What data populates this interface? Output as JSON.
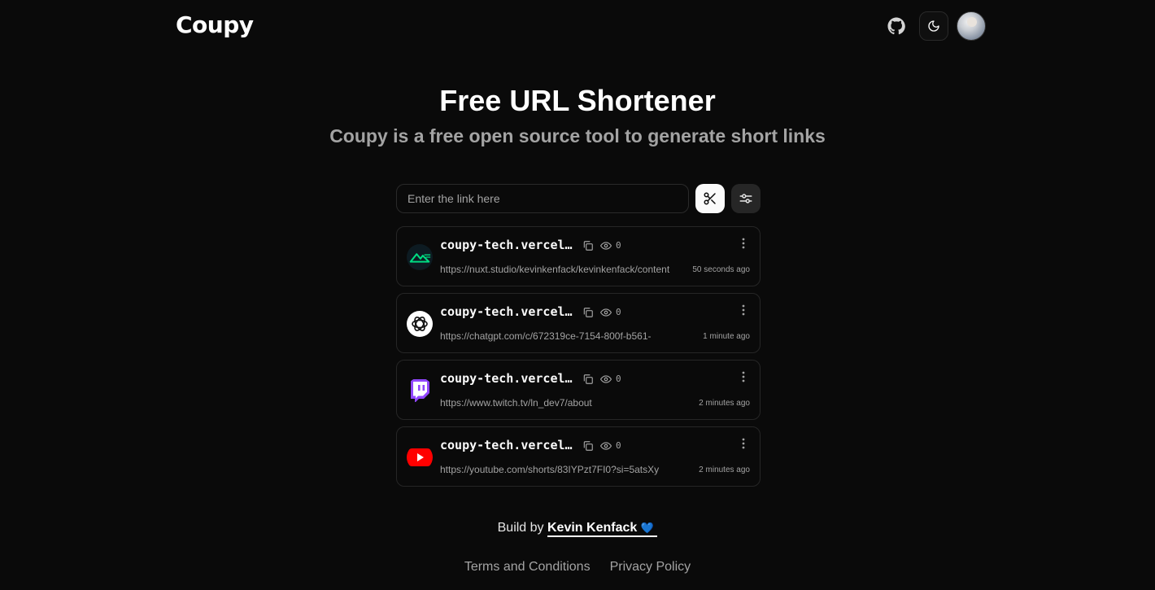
{
  "header": {
    "logo": "Coupy",
    "icons": [
      "github-icon",
      "moon-icon",
      "avatar"
    ]
  },
  "hero": {
    "title": "Free URL Shortener",
    "subtitle": "Coupy is a free open source tool to generate short links"
  },
  "shortener": {
    "input_placeholder": "Enter the link here",
    "input_value": "",
    "cut_icon": "scissors-icon",
    "settings_icon": "sliders-icon"
  },
  "links": [
    {
      "short": "coupy-tech.vercel.app/x",
      "clicks": "0",
      "original": "https://nuxt.studio/kevinkenfack/kevinkenfack/content",
      "time": "50 seconds ago",
      "favicon": "nuxt-studio-icon"
    },
    {
      "short": "coupy-tech.vercel.app/x",
      "clicks": "0",
      "original": "https://chatgpt.com/c/672319ce-7154-800f-b561-",
      "time": "1 minute ago",
      "favicon": "chatgpt-icon"
    },
    {
      "short": "coupy-tech.vercel.app/x",
      "clicks": "0",
      "original": "https://www.twitch.tv/ln_dev7/about",
      "time": "2 minutes ago",
      "favicon": "twitch-icon"
    },
    {
      "short": "coupy-tech.vercel.app/x",
      "clicks": "0",
      "original": "https://youtube.com/shorts/83IYPzt7FI0?si=5atsXy",
      "time": "2 minutes ago",
      "favicon": "youtube-icon"
    }
  ],
  "footer": {
    "build_prefix": "Build by",
    "author": "Kevin Kenfack",
    "heart": "💙",
    "terms": "Terms and Conditions",
    "privacy": "Privacy Policy"
  },
  "colors": {
    "background": "#0a0a0a",
    "card_border": "#262626",
    "muted_text": "#a3a3a3",
    "twitch": "#9146ff",
    "youtube": "#ff0000",
    "nuxt_green": "#00dc82"
  }
}
